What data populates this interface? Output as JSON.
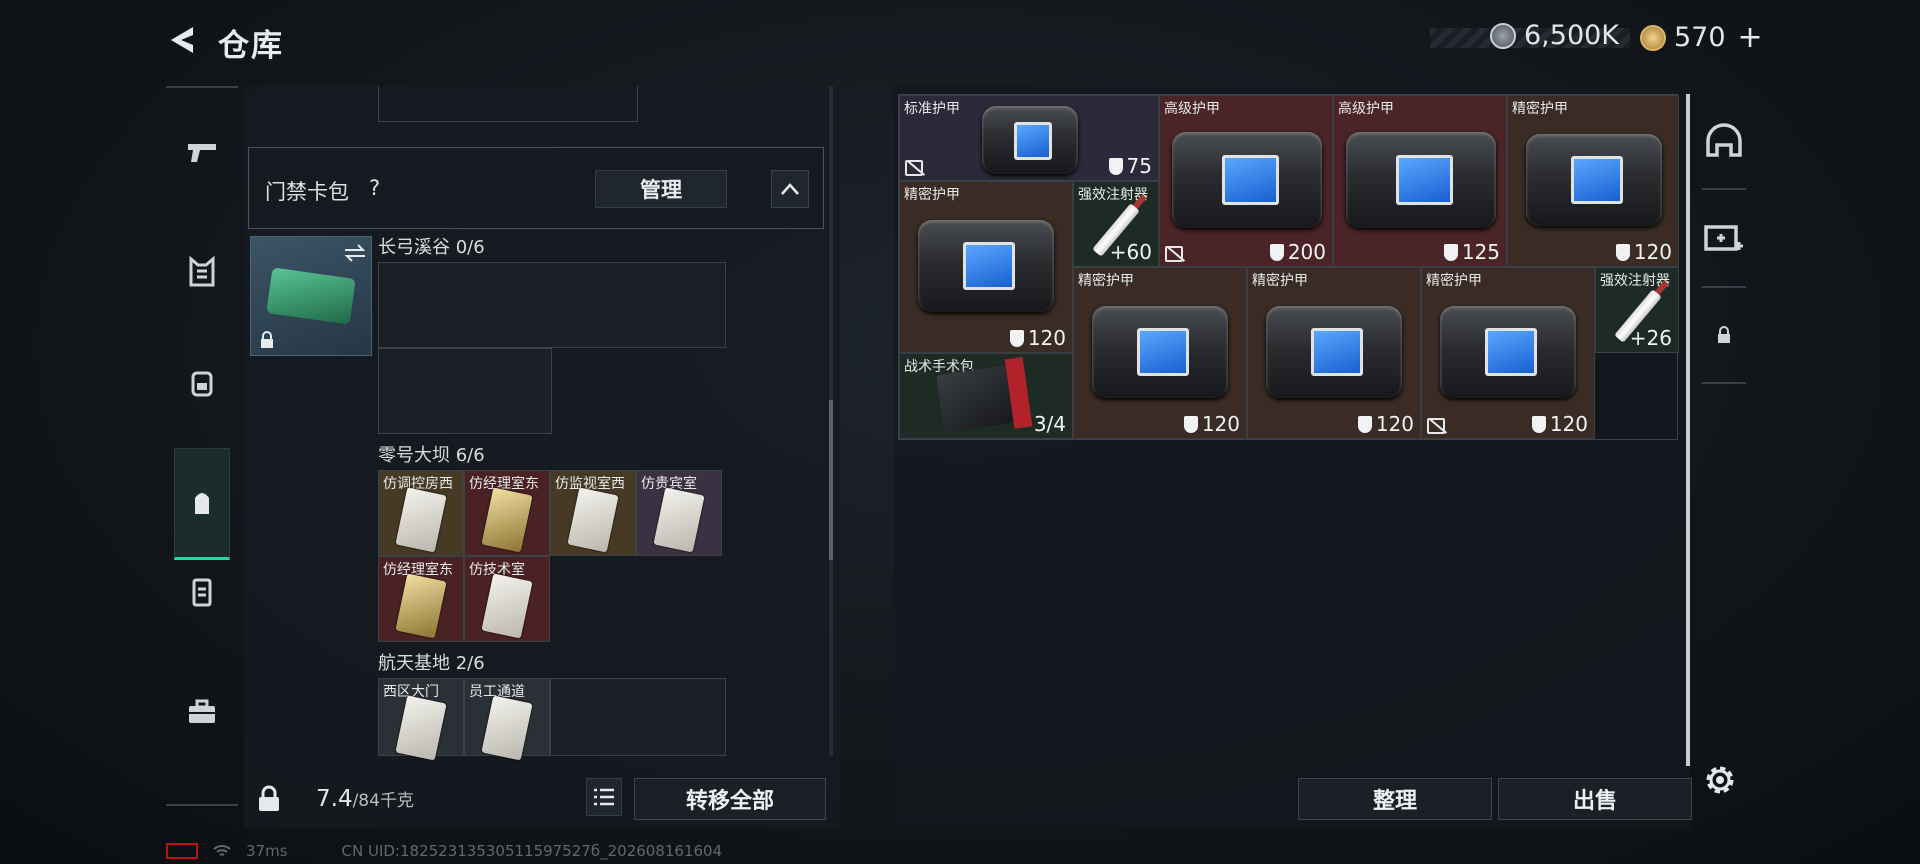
{
  "header": {
    "title": "仓库",
    "coins": "6,500K",
    "tickets": "570"
  },
  "left_panel": {
    "card_pack_label": "门禁卡包",
    "help_mark": "?",
    "manage_button": "管理",
    "sections": [
      {
        "name": "长弓溪谷",
        "count": "0/6"
      },
      {
        "name": "零号大坝",
        "count": "6/6",
        "cards": [
          "仿调控房西",
          "仿经理室东",
          "仿监视室西",
          "仿贵宾室",
          "仿经理室东",
          "仿技术室"
        ]
      },
      {
        "name": "航天基地",
        "count": "2/6",
        "cards": [
          "西区大门",
          "员工通道"
        ]
      }
    ],
    "weight_value": "7.4",
    "weight_capacity": "/84千克",
    "transfer_all_button": "转移全部"
  },
  "stash": {
    "items": [
      {
        "name": "标准护甲",
        "value": "75"
      },
      {
        "name": "高级护甲",
        "value": "200"
      },
      {
        "name": "高级护甲",
        "value": "125"
      },
      {
        "name": "精密护甲",
        "value": "120"
      },
      {
        "name": "精密护甲",
        "value": "120"
      },
      {
        "name": "强效注射器",
        "value": "+60"
      },
      {
        "name": "精密护甲",
        "value": "120"
      },
      {
        "name": "精密护甲",
        "value": "120"
      },
      {
        "name": "精密护甲",
        "value": "120"
      },
      {
        "name": "强效注射器",
        "value": "+26"
      },
      {
        "name": "战术手术包",
        "value": "3/4"
      }
    ],
    "sort_button": "整理",
    "sell_button": "出售"
  },
  "status_bar": {
    "ping": "37ms",
    "uid": "CN UID:18252313530511597527б_202608161604"
  }
}
